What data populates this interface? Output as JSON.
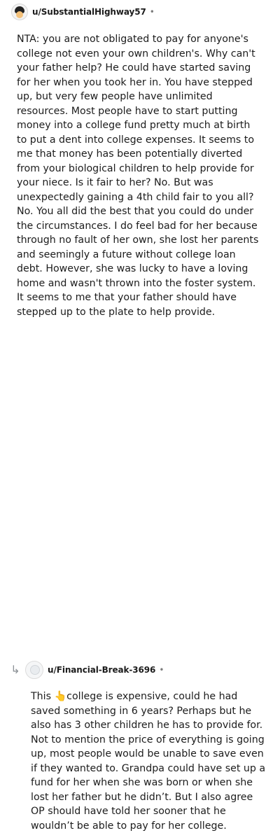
{
  "comments": [
    {
      "username": "u/SubstantialHighway57",
      "separator": "•",
      "avatar_icon": "snoo-avatar-icon",
      "body": "NTA: you are not obligated to pay for anyone's college not even your own children's. Why can't your father help? He could have started saving for her when you took her in. You have stepped up, but very few people have unlimited resources. Most people have to start putting money into a college fund pretty much at birth to put a dent into college expenses. It seems to me that money has been potentially diverted from your biological children to help provide for your niece. Is it fair to her? No. But was unexpectedly gaining a 4th child fair to you all? No. You all did the best that you could do under the circumstances. I do feel bad for her because through no fault of her own, she lost her parents and seemingly a future without college loan debt. However, she was lucky to have a loving home and wasn't thrown into the foster system. It seems to me that your father should have stepped up to the plate to help provide."
    },
    {
      "username": "u/Financial-Break-3696",
      "separator": "•",
      "avatar_icon": "default-avatar-icon",
      "reply_icon": "reply-arrow-icon",
      "body": "This 👆college is expensive, could he had saved something in 6 years? Perhaps but he also has 3 other children he has to provide for. Not to mention the price of everything is going up, most people would be unable to save even if they wanted to. Grandpa could have set up a fund for her when she was born or when she lost her father but he didn’t. But I also agree OP should have told her sooner that he wouldn’t be able to pay for her college."
    }
  ]
}
